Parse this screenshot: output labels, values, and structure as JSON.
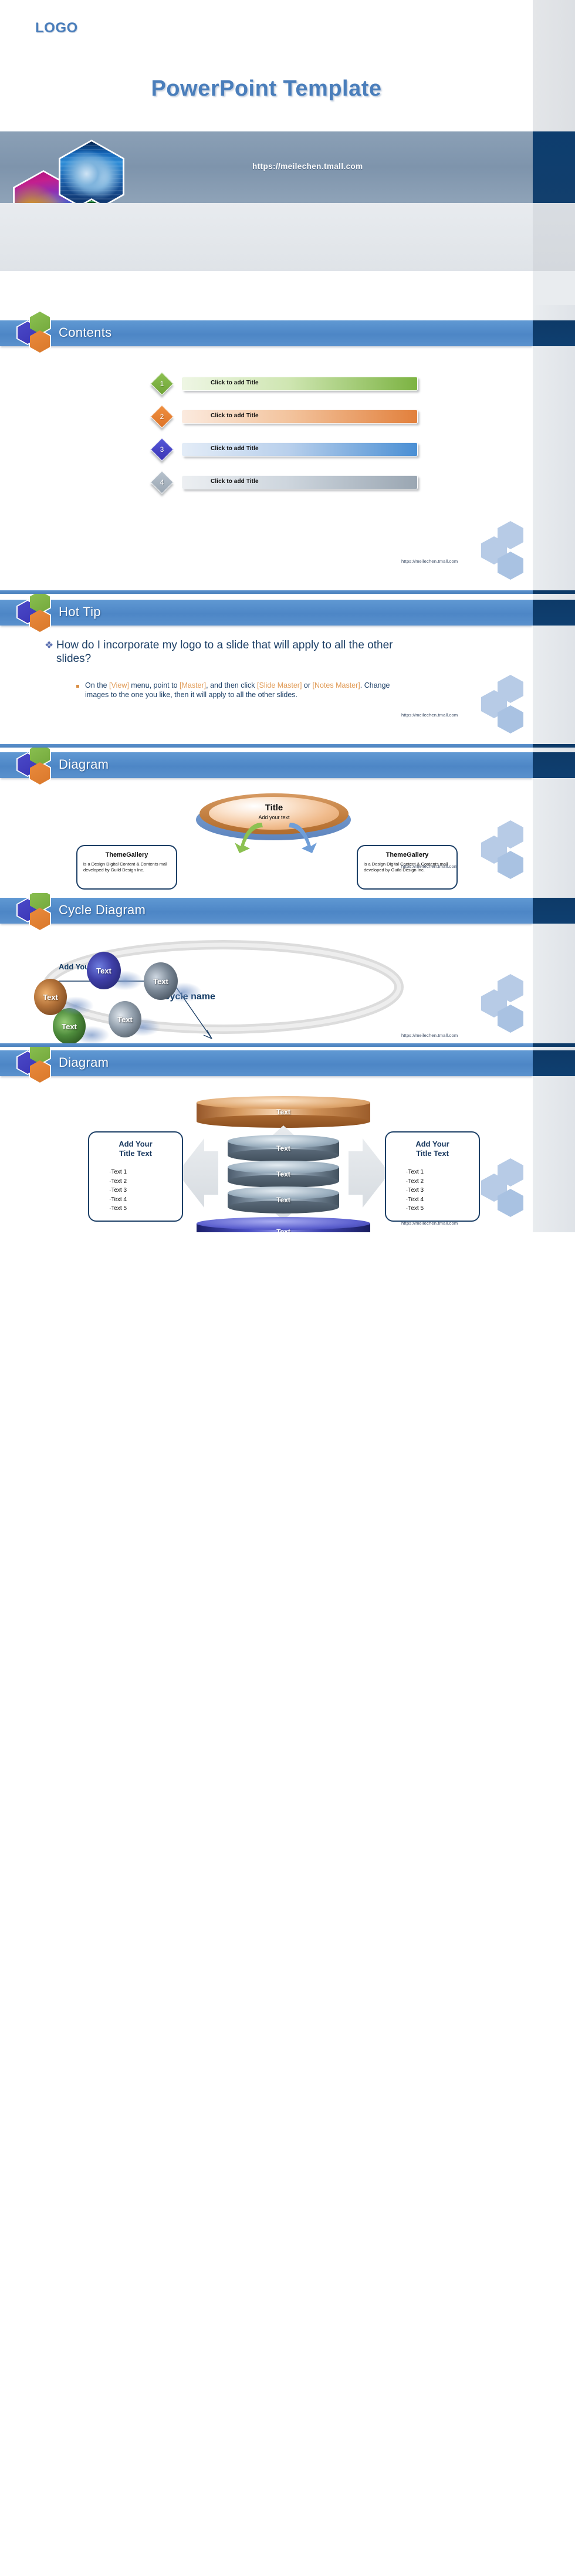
{
  "brand": {
    "logo": "LOGO",
    "url": "https://meilechen.tmall.com",
    "accent_blue": "#4a7ebb",
    "header_blue": "#4d86c6",
    "header_dark": "#0d3a68",
    "navy_text": "#1c3f66",
    "orange": "#e09a55",
    "green": "#8cc152",
    "hex_blue": "#4a49c8",
    "hex_orange": "#ea8a3c"
  },
  "slides": [
    {
      "id": "title",
      "logo": "LOGO",
      "title": "PowerPoint Template",
      "banner_url": "https://meilechen.tmall.com",
      "photos": [
        "handshake-photo",
        "business-people-photo",
        "network-grid-photo"
      ]
    },
    {
      "id": "contents",
      "title": "Contents",
      "footer_url": "https://meilechen.tmall.com",
      "rows": [
        {
          "number": "1",
          "label": "Click to add Title",
          "color": "#7cb342",
          "light": "#eef6e4"
        },
        {
          "number": "2",
          "label": "Click to add Title",
          "color": "#e2803c",
          "light": "#fbeade"
        },
        {
          "number": "3",
          "label": "Click to add Title",
          "color": "#4a8fd4",
          "light": "#e3ecf7"
        },
        {
          "number": "4",
          "label": "Click to add Title",
          "color": "#9aa6b2",
          "light": "#eceff2"
        }
      ]
    },
    {
      "id": "hot-tip",
      "title": "Hot Tip",
      "footer_url": "https://meilechen.tmall.com",
      "question": "How do I incorporate my logo to a slide that will apply to all the other slides?",
      "answer_parts": [
        {
          "text": "On the ",
          "highlight": false
        },
        {
          "text": "[View]",
          "highlight": true
        },
        {
          "text": " menu, point to ",
          "highlight": false
        },
        {
          "text": "[Master]",
          "highlight": true
        },
        {
          "text": ", and then click ",
          "highlight": false
        },
        {
          "text": "[Slide Master]",
          "highlight": true
        },
        {
          "text": " or ",
          "highlight": false
        },
        {
          "text": "[Notes Master]",
          "highlight": true
        },
        {
          "text": ". Change images to the one you like, then it will apply to all the other slides.",
          "highlight": false
        }
      ]
    },
    {
      "id": "diagram-1",
      "title": "Diagram",
      "footer_url": "https://meilechen.tmall.com",
      "center_title": "Title",
      "center_sub": "Add your text",
      "boxes": [
        {
          "heading": "ThemeGallery",
          "body": "is a Design Digital Content & Contents mall developed by Guild Design Inc."
        },
        {
          "heading": "ThemeGallery",
          "body": "is a Design Digital Content & Contents mall developed by Guild Design Inc."
        }
      ]
    },
    {
      "id": "cycle-diagram",
      "title": "Cycle Diagram",
      "footer_url": "https://meilechen.tmall.com",
      "callout": "Add Your Text",
      "cycle_name": "Cycle name",
      "nodes": [
        {
          "label": "Text",
          "color": "navy"
        },
        {
          "label": "Text",
          "color": "slate"
        },
        {
          "label": "Text",
          "color": "gray"
        },
        {
          "label": "Text",
          "color": "green"
        },
        {
          "label": "Text",
          "color": "brown"
        }
      ]
    },
    {
      "id": "diagram-2",
      "title": "Diagram",
      "footer_url": "https://meilechen.tmall.com",
      "top_cylinder": "Text",
      "stack": [
        "Text",
        "Text",
        "Text"
      ],
      "bottom_cylinder": "Text",
      "side_boxes": [
        {
          "title": "Add Your\nTitle Text",
          "items": [
            "Text 1",
            "Text 2",
            "Text 3",
            "Text 4",
            "Text 5"
          ]
        },
        {
          "title": "Add Your\nTitle Text",
          "items": [
            "Text 1",
            "Text 2",
            "Text 3",
            "Text 4",
            "Text 5"
          ]
        }
      ]
    }
  ]
}
